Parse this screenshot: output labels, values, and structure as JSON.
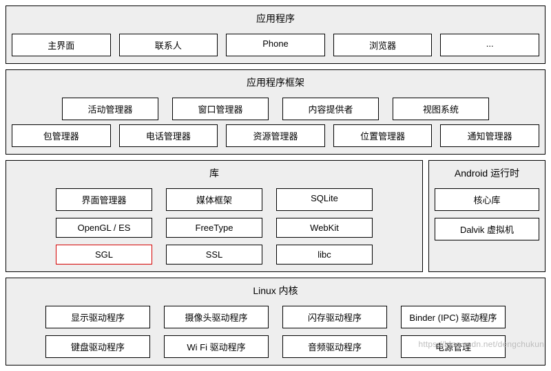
{
  "applications": {
    "title": "应用程序",
    "items": [
      "主界面",
      "联系人",
      "Phone",
      "浏览器",
      "..."
    ]
  },
  "framework": {
    "title": "应用程序框架",
    "row1": [
      "活动管理器",
      "窗口管理器",
      "内容提供者",
      "视图系统"
    ],
    "row2": [
      "包管理器",
      "电话管理器",
      "资源管理器",
      "位置管理器",
      "通知管理器"
    ]
  },
  "libraries": {
    "title": "库",
    "items": [
      "界面管理器",
      "媒体框架",
      "SQLite",
      "OpenGL / ES",
      "FreeType",
      "WebKit",
      "SGL",
      "SSL",
      "libc"
    ],
    "highlighted": "SGL"
  },
  "runtime": {
    "title": "Android 运行时",
    "items": [
      "核心库",
      "Dalvik 虚拟机"
    ]
  },
  "kernel": {
    "title": "Linux 内核",
    "items": [
      "显示驱动程序",
      "摄像头驱动程序",
      "闪存驱动程序",
      "Binder (IPC) 驱动程序",
      "键盘驱动程序",
      "Wi Fi 驱动程序",
      "音频驱动程序",
      "电源管理"
    ]
  },
  "watermark": "https://blog.csdn.net/dengchukun"
}
